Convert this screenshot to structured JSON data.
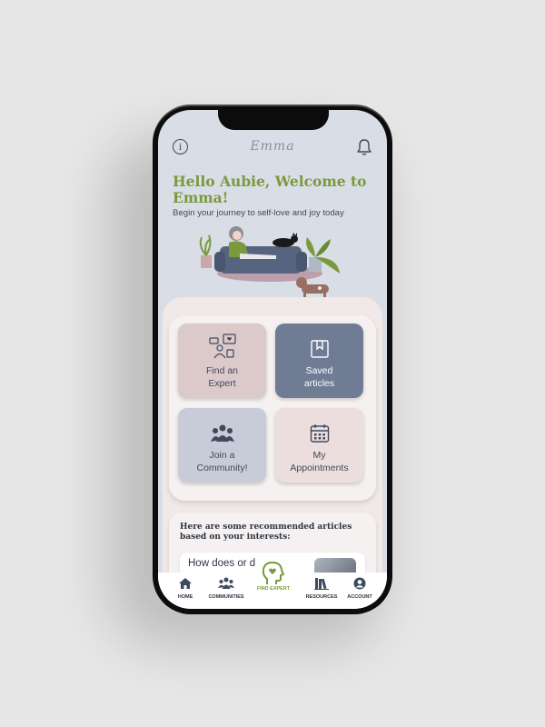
{
  "app": {
    "logo_text": "Emma",
    "accent_green": "#7a9a3c",
    "navy": "#3e4a5e"
  },
  "header": {
    "info_icon": "info-icon",
    "bell_icon": "bell-icon",
    "greeting": "Hello Aubie, Welcome to Emma!",
    "subtitle": "Begin your journey to self-love and joy today"
  },
  "tiles": [
    {
      "label_line1": "Find an",
      "label_line2": "Expert",
      "icon": "expert-network-icon",
      "color": "#dcc9ca"
    },
    {
      "label_line1": "Saved",
      "label_line2": "articles",
      "icon": "bookmark-icon",
      "color": "#707c94"
    },
    {
      "label_line1": "Join a",
      "label_line2": "Community!",
      "icon": "community-icon",
      "color": "#c7ccd8"
    },
    {
      "label_line1": "My",
      "label_line2": "Appointments",
      "icon": "calendar-icon",
      "color": "#ebdedd"
    }
  ],
  "recommended": {
    "title_line1": "Here are some recommended articles",
    "title_line2": "based on your interests:",
    "article_title": "How does or         d"
  },
  "nav": {
    "home": "HOME",
    "communities": "COMMUNITIES",
    "find_expert": "FIND EXPERT",
    "resources": "RESOURCES",
    "account": "ACCOUNT"
  }
}
